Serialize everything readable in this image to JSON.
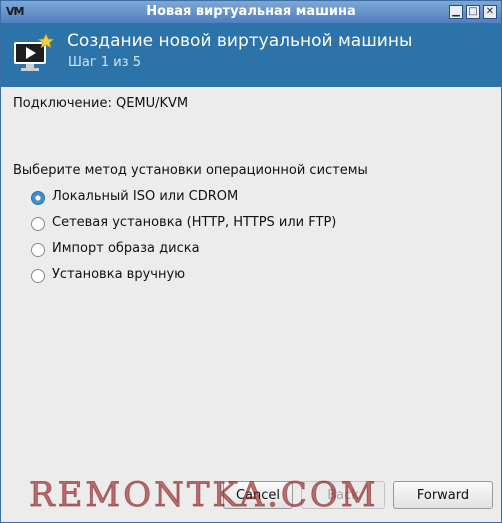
{
  "window": {
    "title": "Новая виртуальная машина",
    "app_icon": "virt-manager-icon"
  },
  "header": {
    "title": "Создание новой виртуальной машины",
    "step": "Шаг 1 из 5"
  },
  "connection": {
    "text": "Подключение:  QEMU/KVM"
  },
  "install": {
    "prompt": "Выберите метод установки операционной системы",
    "options": [
      {
        "label": "Локальный ISO или CDROM",
        "selected": true
      },
      {
        "label": "Сетевая установка (HTTP, HTTPS или FTP)",
        "selected": false
      },
      {
        "label": "Импорт образа диска",
        "selected": false
      },
      {
        "label": "Установка вручную",
        "selected": false
      }
    ]
  },
  "buttons": {
    "cancel": "Cancel",
    "back": "Back",
    "forward": "Forward"
  },
  "watermark": "REMONTKA.COM",
  "colors": {
    "header_bg": "#2b73a8",
    "selected_radio": "#3f8fd0"
  }
}
